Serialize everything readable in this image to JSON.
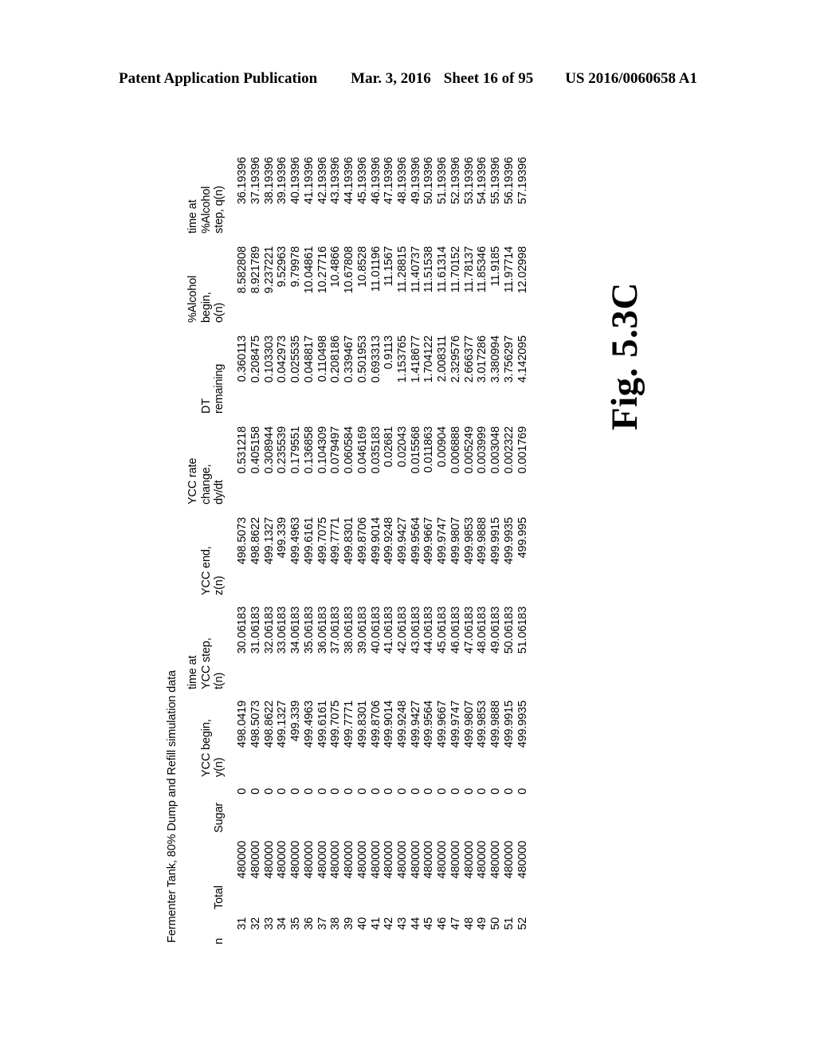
{
  "header": {
    "publication": "Patent Application Publication",
    "date": "Mar. 3, 2016",
    "sheet": "Sheet 16 of 95",
    "docket": "US 2016/0060658 A1"
  },
  "figure": {
    "caption": "Fig. 5.3C"
  },
  "table": {
    "title": "Fermenter Tank, 80% Dump and Refill simulation data",
    "columns": [
      {
        "id": "n",
        "lines": [
          "n"
        ]
      },
      {
        "id": "total",
        "lines": [
          "Total"
        ]
      },
      {
        "id": "sugar",
        "lines": [
          "Sugar"
        ]
      },
      {
        "id": "y",
        "lines": [
          "YCC begin,",
          "y(n)"
        ]
      },
      {
        "id": "t",
        "lines": [
          "time at",
          "YCC step,",
          "t(n)"
        ]
      },
      {
        "id": "z",
        "lines": [
          "YCC end,",
          "z(n)"
        ]
      },
      {
        "id": "dydt",
        "lines": [
          "YCC rate",
          "change,",
          "dy/dt"
        ]
      },
      {
        "id": "dt",
        "lines": [
          "DT",
          "remaining"
        ]
      },
      {
        "id": "o",
        "lines": [
          "%Alcohol",
          "begin,",
          "o(n)"
        ]
      },
      {
        "id": "q",
        "lines": [
          "time at",
          "%Alcohol",
          "step, q(n)"
        ]
      }
    ],
    "rows": [
      {
        "n": "31",
        "total": "480000",
        "sugar": "0",
        "y": "498.0419",
        "t": "30.06183",
        "z": "498.5073",
        "dydt": "0.531218",
        "dt": "0.360113",
        "o": "8.582808",
        "q": "36.19396"
      },
      {
        "n": "32",
        "total": "480000",
        "sugar": "0",
        "y": "498.5073",
        "t": "31.06183",
        "z": "498.8622",
        "dydt": "0.405158",
        "dt": "0.208475",
        "o": "8.921789",
        "q": "37.19396"
      },
      {
        "n": "33",
        "total": "480000",
        "sugar": "0",
        "y": "498.8622",
        "t": "32.06183",
        "z": "499.1327",
        "dydt": "0.308944",
        "dt": "0.103303",
        "o": "9.237221",
        "q": "38.19396"
      },
      {
        "n": "34",
        "total": "480000",
        "sugar": "0",
        "y": "499.1327",
        "t": "33.06183",
        "z": "499.339",
        "dydt": "0.235539",
        "dt": "0.042973",
        "o": "9.52963",
        "q": "39.19396"
      },
      {
        "n": "35",
        "total": "480000",
        "sugar": "0",
        "y": "499.339",
        "t": "34.06183",
        "z": "499.4963",
        "dydt": "0.179551",
        "dt": "0.025535",
        "o": "9.79978",
        "q": "40.19396"
      },
      {
        "n": "36",
        "total": "480000",
        "sugar": "0",
        "y": "499.4963",
        "t": "35.06183",
        "z": "499.6161",
        "dydt": "0.136858",
        "dt": "0.048817",
        "o": "10.04861",
        "q": "41.19396"
      },
      {
        "n": "37",
        "total": "480000",
        "sugar": "0",
        "y": "499.6161",
        "t": "36.06183",
        "z": "499.7075",
        "dydt": "0.104309",
        "dt": "0.110498",
        "o": "10.27716",
        "q": "42.19396"
      },
      {
        "n": "38",
        "total": "480000",
        "sugar": "0",
        "y": "499.7075",
        "t": "37.06183",
        "z": "499.7771",
        "dydt": "0.079497",
        "dt": "0.208186",
        "o": "10.4866",
        "q": "43.19396"
      },
      {
        "n": "39",
        "total": "480000",
        "sugar": "0",
        "y": "499.7771",
        "t": "38.06183",
        "z": "499.8301",
        "dydt": "0.060584",
        "dt": "0.339467",
        "o": "10.67808",
        "q": "44.19396"
      },
      {
        "n": "40",
        "total": "480000",
        "sugar": "0",
        "y": "499.8301",
        "t": "39.06183",
        "z": "499.8706",
        "dydt": "0.046169",
        "dt": "0.501953",
        "o": "10.8528",
        "q": "45.19396"
      },
      {
        "n": "41",
        "total": "480000",
        "sugar": "0",
        "y": "499.8706",
        "t": "40.06183",
        "z": "499.9014",
        "dydt": "0.035183",
        "dt": "0.693313",
        "o": "11.01196",
        "q": "46.19396"
      },
      {
        "n": "42",
        "total": "480000",
        "sugar": "0",
        "y": "499.9014",
        "t": "41.06183",
        "z": "499.9248",
        "dydt": "0.02681",
        "dt": "0.9113",
        "o": "11.1567",
        "q": "47.19396"
      },
      {
        "n": "43",
        "total": "480000",
        "sugar": "0",
        "y": "499.9248",
        "t": "42.06183",
        "z": "499.9427",
        "dydt": "0.02043",
        "dt": "1.153765",
        "o": "11.28815",
        "q": "48.19396"
      },
      {
        "n": "44",
        "total": "480000",
        "sugar": "0",
        "y": "499.9427",
        "t": "43.06183",
        "z": "499.9564",
        "dydt": "0.015568",
        "dt": "1.418677",
        "o": "11.40737",
        "q": "49.19396"
      },
      {
        "n": "45",
        "total": "480000",
        "sugar": "0",
        "y": "499.9564",
        "t": "44.06183",
        "z": "499.9667",
        "dydt": "0.011863",
        "dt": "1.704122",
        "o": "11.51538",
        "q": "50.19396"
      },
      {
        "n": "46",
        "total": "480000",
        "sugar": "0",
        "y": "499.9667",
        "t": "45.06183",
        "z": "499.9747",
        "dydt": "0.00904",
        "dt": "2.008311",
        "o": "11.61314",
        "q": "51.19396"
      },
      {
        "n": "47",
        "total": "480000",
        "sugar": "0",
        "y": "499.9747",
        "t": "46.06183",
        "z": "499.9807",
        "dydt": "0.006888",
        "dt": "2.329576",
        "o": "11.70152",
        "q": "52.19396"
      },
      {
        "n": "48",
        "total": "480000",
        "sugar": "0",
        "y": "499.9807",
        "t": "47.06183",
        "z": "499.9853",
        "dydt": "0.005249",
        "dt": "2.666377",
        "o": "11.78137",
        "q": "53.19396"
      },
      {
        "n": "49",
        "total": "480000",
        "sugar": "0",
        "y": "499.9853",
        "t": "48.06183",
        "z": "499.9888",
        "dydt": "0.003999",
        "dt": "3.017286",
        "o": "11.85346",
        "q": "54.19396"
      },
      {
        "n": "50",
        "total": "480000",
        "sugar": "0",
        "y": "499.9888",
        "t": "49.06183",
        "z": "499.9915",
        "dydt": "0.003048",
        "dt": "3.380994",
        "o": "11.9185",
        "q": "55.19396"
      },
      {
        "n": "51",
        "total": "480000",
        "sugar": "0",
        "y": "499.9915",
        "t": "50.06183",
        "z": "499.9935",
        "dydt": "0.002322",
        "dt": "3.756297",
        "o": "11.97714",
        "q": "56.19396"
      },
      {
        "n": "52",
        "total": "480000",
        "sugar": "0",
        "y": "499.9935",
        "t": "51.06183",
        "z": "499.995",
        "dydt": "0.001769",
        "dt": "4.142095",
        "o": "12.02998",
        "q": "57.19396"
      }
    ]
  }
}
